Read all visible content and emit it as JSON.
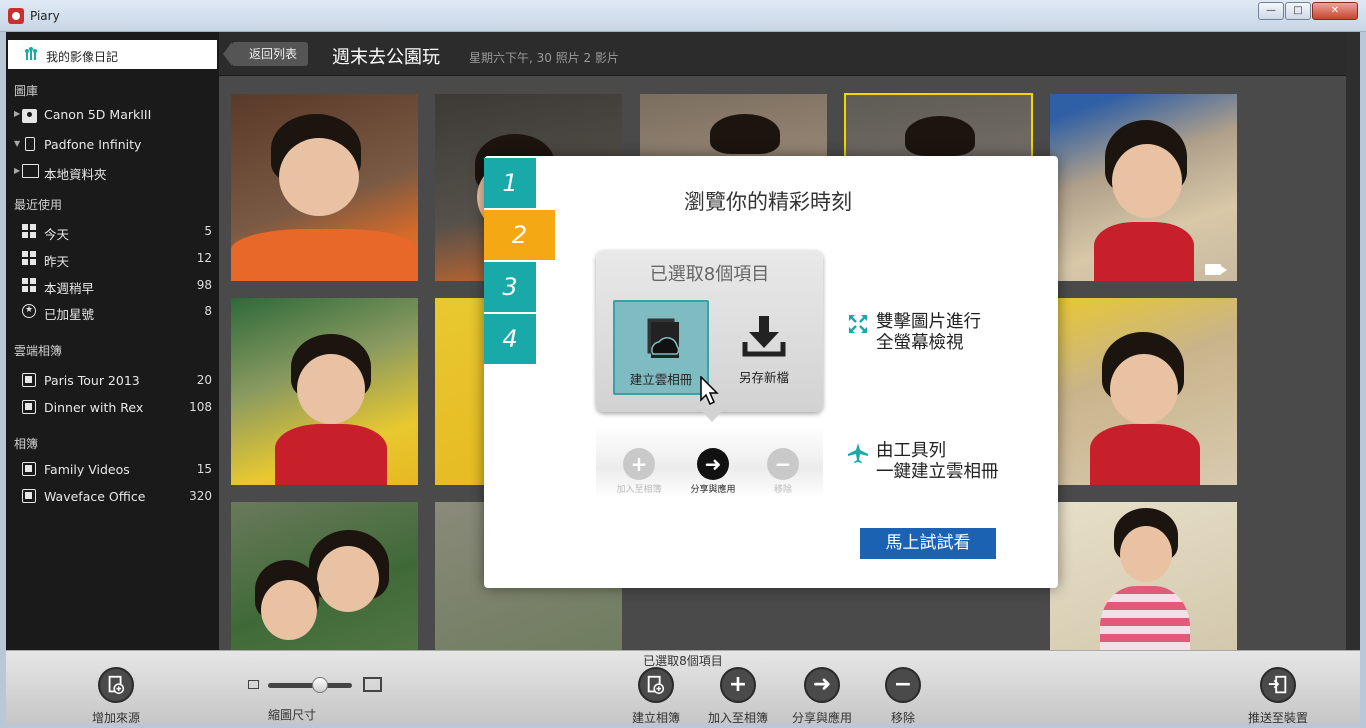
{
  "window": {
    "title": "Piary",
    "minimize": "—",
    "maximize": "□",
    "close": "✕"
  },
  "sidebar": {
    "home": "我的影像日記",
    "library_title": "圖庫",
    "library": [
      {
        "label": "Canon 5D MarkIII",
        "icon": "camera-icon"
      },
      {
        "label": "Padfone Infinity",
        "icon": "phone-icon"
      },
      {
        "label": "本地資料夾",
        "icon": "monitor-icon"
      }
    ],
    "recent_title": "最近使用",
    "recent": [
      {
        "label": "今天",
        "count": "5"
      },
      {
        "label": "昨天",
        "count": "12"
      },
      {
        "label": "本週稍早",
        "count": "98"
      },
      {
        "label": "已加星號",
        "count": "8"
      }
    ],
    "cloud_title": "雲端相簿",
    "cloud": [
      {
        "label": "Paris Tour 2013",
        "count": "20"
      },
      {
        "label": "Dinner with Rex",
        "count": "108"
      }
    ],
    "albums_title": "相簿",
    "albums": [
      {
        "label": "Family Videos",
        "count": "15"
      },
      {
        "label": "Waveface Office",
        "count": "320"
      }
    ]
  },
  "header": {
    "back": "返回列表",
    "title": "週末去公園玩",
    "meta": "星期六下午, 30 照片 2 影片"
  },
  "overlay": {
    "tabs": [
      "1",
      "2",
      "3",
      "4"
    ],
    "active_tab": "2",
    "title": "瀏覽你的精彩時刻",
    "panel_title": "已選取8個項目",
    "create_album": "建立雲相冊",
    "save_as": "另存新檔",
    "mini_tools": [
      "加入至相簿",
      "分享與應用",
      "移除"
    ],
    "hint1": [
      "雙擊圖片進行",
      "全螢幕檢視"
    ],
    "hint2": [
      "由工具列",
      "一鍵建立雲相冊"
    ],
    "try_button": "馬上試試看"
  },
  "toolbar": {
    "selected_label": "已選取8個項目",
    "add_source": "增加來源",
    "thumb_size": "縮圖尺寸",
    "create_album": "建立相簿",
    "add_to_album": "加入至相簿",
    "share": "分享與應用",
    "remove": "移除",
    "push_device": "推送至裝置"
  },
  "colors": {
    "accent_teal": "#19a9a9",
    "accent_orange": "#f4a814",
    "try_blue": "#1c62b3",
    "selection": "#f1d700"
  }
}
